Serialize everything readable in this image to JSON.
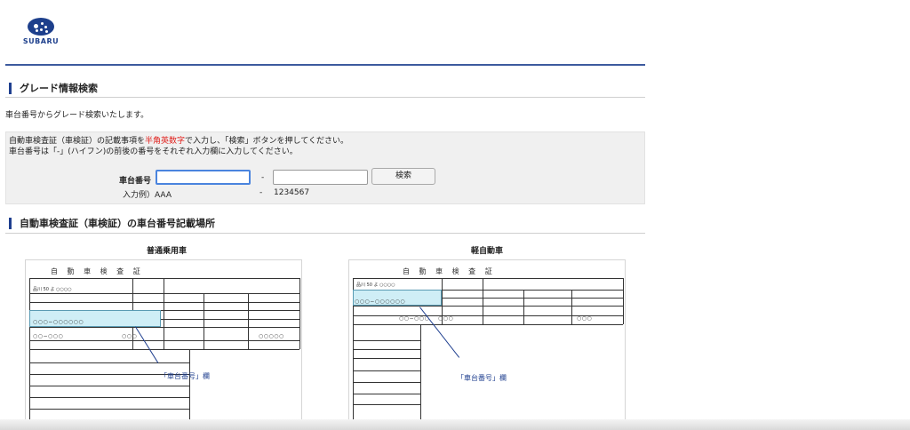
{
  "brand": {
    "name": "SUBARU",
    "logo_icon": "subaru-star-logo",
    "color": "#1d3f8c"
  },
  "section1": {
    "title": "グレード情報検索"
  },
  "lead_text": "車台番号からグレード検索いたします。",
  "instructions": {
    "line1_pre": "自動車検査証（車検証）の記載事項を",
    "line1_red": "半角英数字",
    "line1_post": "で入力し、「検索」ボタンを押してください。",
    "line2": "車台番号は「-」(ハイフン)の前後の番号をそれぞれ入力欄に入力してください。",
    "highlight_color": "#e0201c"
  },
  "search_form": {
    "label": "車台番号",
    "field1_value": "",
    "field2_value": "",
    "separator": "-",
    "button_label": "検索",
    "example_label": "入力例）AAA",
    "example_separator": "-",
    "example_value": "1234567"
  },
  "section2": {
    "title": "自動車検査証（車検証）の車台番号記載場所"
  },
  "figures": [
    {
      "caption": "普通乗用車",
      "doc_title": "自 動 車 検 査 証",
      "chassis_placeholder": "○○○−○○○○○○",
      "plate": "品川 50 よ ○○○○",
      "callout": "「車台番号」欄"
    },
    {
      "caption": "軽自動車",
      "doc_title": "自 動 車 検 査 証",
      "chassis_placeholder": "○○○−○○○○○○",
      "plate": "品川 50 よ ○○○○",
      "callout": "「車台番号」欄"
    }
  ]
}
